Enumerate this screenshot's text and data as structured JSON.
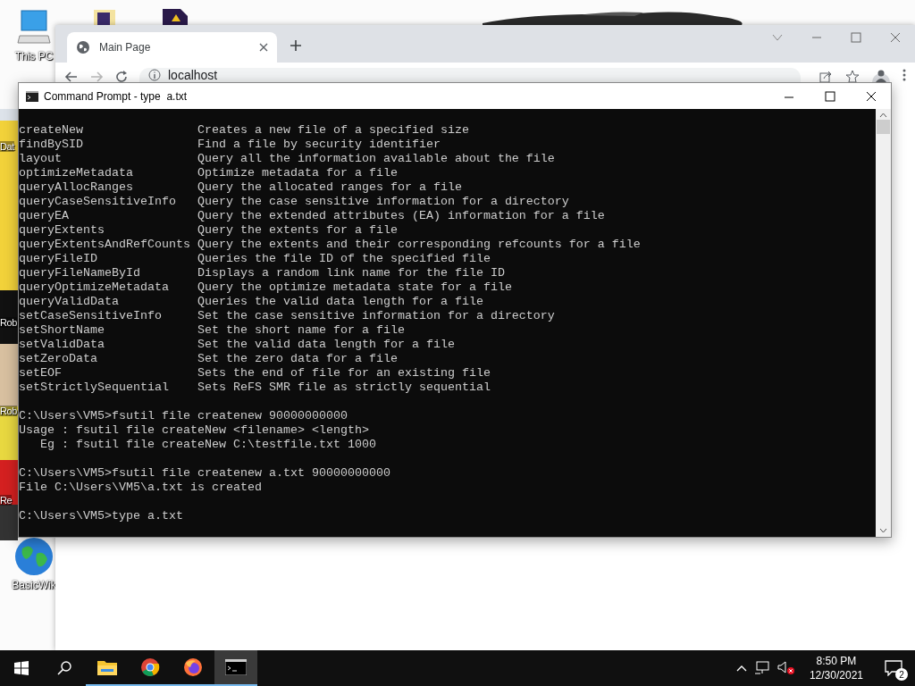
{
  "desktop": {
    "icons": [
      {
        "label": "This PC",
        "kind": "computer"
      },
      {
        "label": "BasicWik",
        "kind": "globe"
      }
    ],
    "partial_labels": [
      "Dat",
      "Rob",
      "Rob",
      "Re"
    ]
  },
  "browser": {
    "tab_title": "Main Page",
    "address": "localhost"
  },
  "console": {
    "title": "Command Prompt - type  a.txt",
    "blocks": [
      [
        "createNew                Creates a new file of a specified size",
        "findBySID                Find a file by security identifier",
        "layout                   Query all the information available about the file",
        "optimizeMetadata         Optimize metadata for a file",
        "queryAllocRanges         Query the allocated ranges for a file",
        "queryCaseSensitiveInfo   Query the case sensitive information for a directory",
        "queryEA                  Query the extended attributes (EA) information for a file",
        "queryExtents             Query the extents for a file",
        "queryExtentsAndRefCounts Query the extents and their corresponding refcounts for a file",
        "queryFileID              Queries the file ID of the specified file",
        "queryFileNameById        Displays a random link name for the file ID",
        "queryOptimizeMetadata    Query the optimize metadata state for a file",
        "queryValidData           Queries the valid data length for a file",
        "setCaseSensitiveInfo     Set the case sensitive information for a directory",
        "setShortName             Set the short name for a file",
        "setValidData             Set the valid data length for a file",
        "setZeroData              Set the zero data for a file",
        "setEOF                   Sets the end of file for an existing file",
        "setStrictlySequential    Sets ReFS SMR file as strictly sequential"
      ],
      [
        "C:\\Users\\VM5>fsutil file createnew 90000000000",
        "Usage : fsutil file createNew <filename> <length>",
        "   Eg : fsutil file createNew C:\\testfile.txt 1000"
      ],
      [
        "C:\\Users\\VM5>fsutil file createnew a.txt 90000000000",
        "File C:\\Users\\VM5\\a.txt is created"
      ],
      [
        "C:\\Users\\VM5>type a.txt"
      ]
    ]
  },
  "taskbar": {
    "apps": [
      {
        "kind": "explorer",
        "selected": false
      },
      {
        "kind": "chrome",
        "selected": false
      },
      {
        "kind": "firefox",
        "selected": false
      },
      {
        "kind": "cmd",
        "selected": true
      }
    ],
    "time": "8:50 PM",
    "date": "12/30/2021",
    "notification_count": "2"
  }
}
